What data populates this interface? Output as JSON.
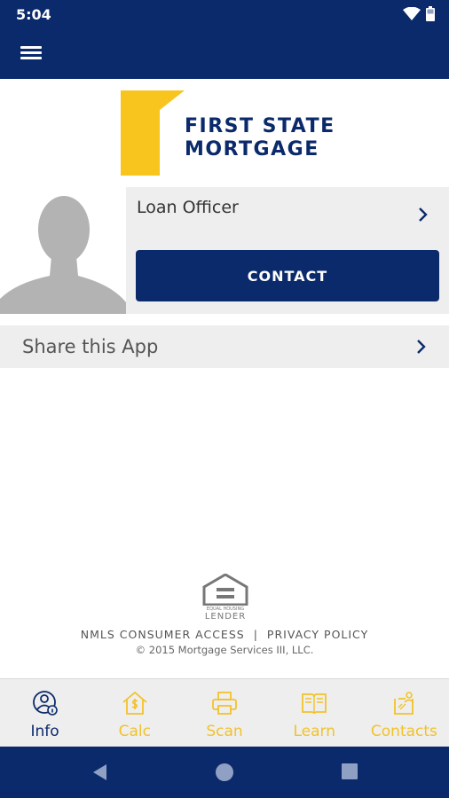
{
  "status_bar": {
    "time": "5:04",
    "icons": [
      "wifi-icon",
      "battery-icon"
    ]
  },
  "app_bar": {
    "menu_icon": "hamburger-menu-icon"
  },
  "logo": {
    "line1": "FIRST STATE",
    "line2": "MORTGAGE",
    "brand_yellow": "#f7c51e",
    "brand_navy": "#0b2a6b"
  },
  "officer": {
    "title": "Loan Officer",
    "contact_label": "CONTACT"
  },
  "share": {
    "label": "Share this App"
  },
  "footer": {
    "eho_line1": "EQUAL HOUSING",
    "eho_line2": "LENDER",
    "nmls_link": "NMLS CONSUMER ACCESS",
    "separator": "|",
    "privacy_link": "PRIVACY POLICY",
    "copyright": "© 2015 Mortgage Services III, LLC."
  },
  "tabs": [
    {
      "label": "Info",
      "icon": "person-info-icon",
      "active": true
    },
    {
      "label": "Calc",
      "icon": "house-dollar-icon",
      "active": false
    },
    {
      "label": "Scan",
      "icon": "printer-scan-icon",
      "active": false
    },
    {
      "label": "Learn",
      "icon": "book-icon",
      "active": false
    },
    {
      "label": "Contacts",
      "icon": "contacts-icon",
      "active": false
    }
  ],
  "colors": {
    "active_tab": "#0b2a6b",
    "inactive_tab": "#f2c22a"
  },
  "nav_bar": {
    "buttons": [
      "back-icon",
      "home-icon",
      "recents-icon"
    ]
  }
}
